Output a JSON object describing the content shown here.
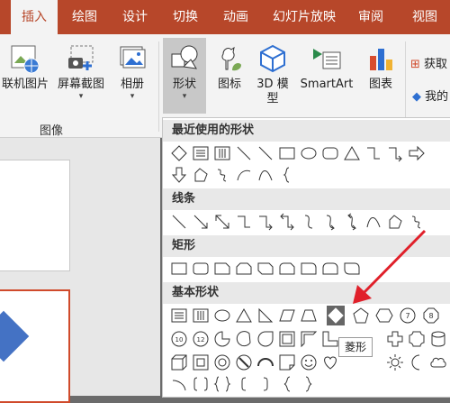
{
  "tabs": [
    "插入",
    "绘图",
    "设计",
    "切换",
    "动画",
    "幻灯片放映",
    "审阅",
    "视图"
  ],
  "ribbon": {
    "online_pictures": "联机图片",
    "screenshot": "屏幕截图",
    "album": "相册",
    "shapes": "形状",
    "icons": "图标",
    "model3d_line1": "3D 模",
    "model3d_line2": "型",
    "smartart": "SmartArt",
    "chart": "图表",
    "get_addins": "获取",
    "my_addins": "我的",
    "images_group": "图像",
    "dropdown_caret": "▾"
  },
  "panel": {
    "recent": "最近使用的形状",
    "lines": "线条",
    "rectangles": "矩形",
    "basic": "基本形状"
  },
  "tooltip": "菱形",
  "colors": {
    "accent": "#b7472a",
    "highlight": "#666666",
    "arrow": "#e0202a",
    "shape_blue": "#4472c4"
  },
  "icons": [
    "picture-globe-icon",
    "screenshot-icon",
    "album-icon",
    "shapes-icon",
    "icons-icon",
    "3d-cube-icon",
    "smartart-icon",
    "chart-icon",
    "store-icon"
  ]
}
